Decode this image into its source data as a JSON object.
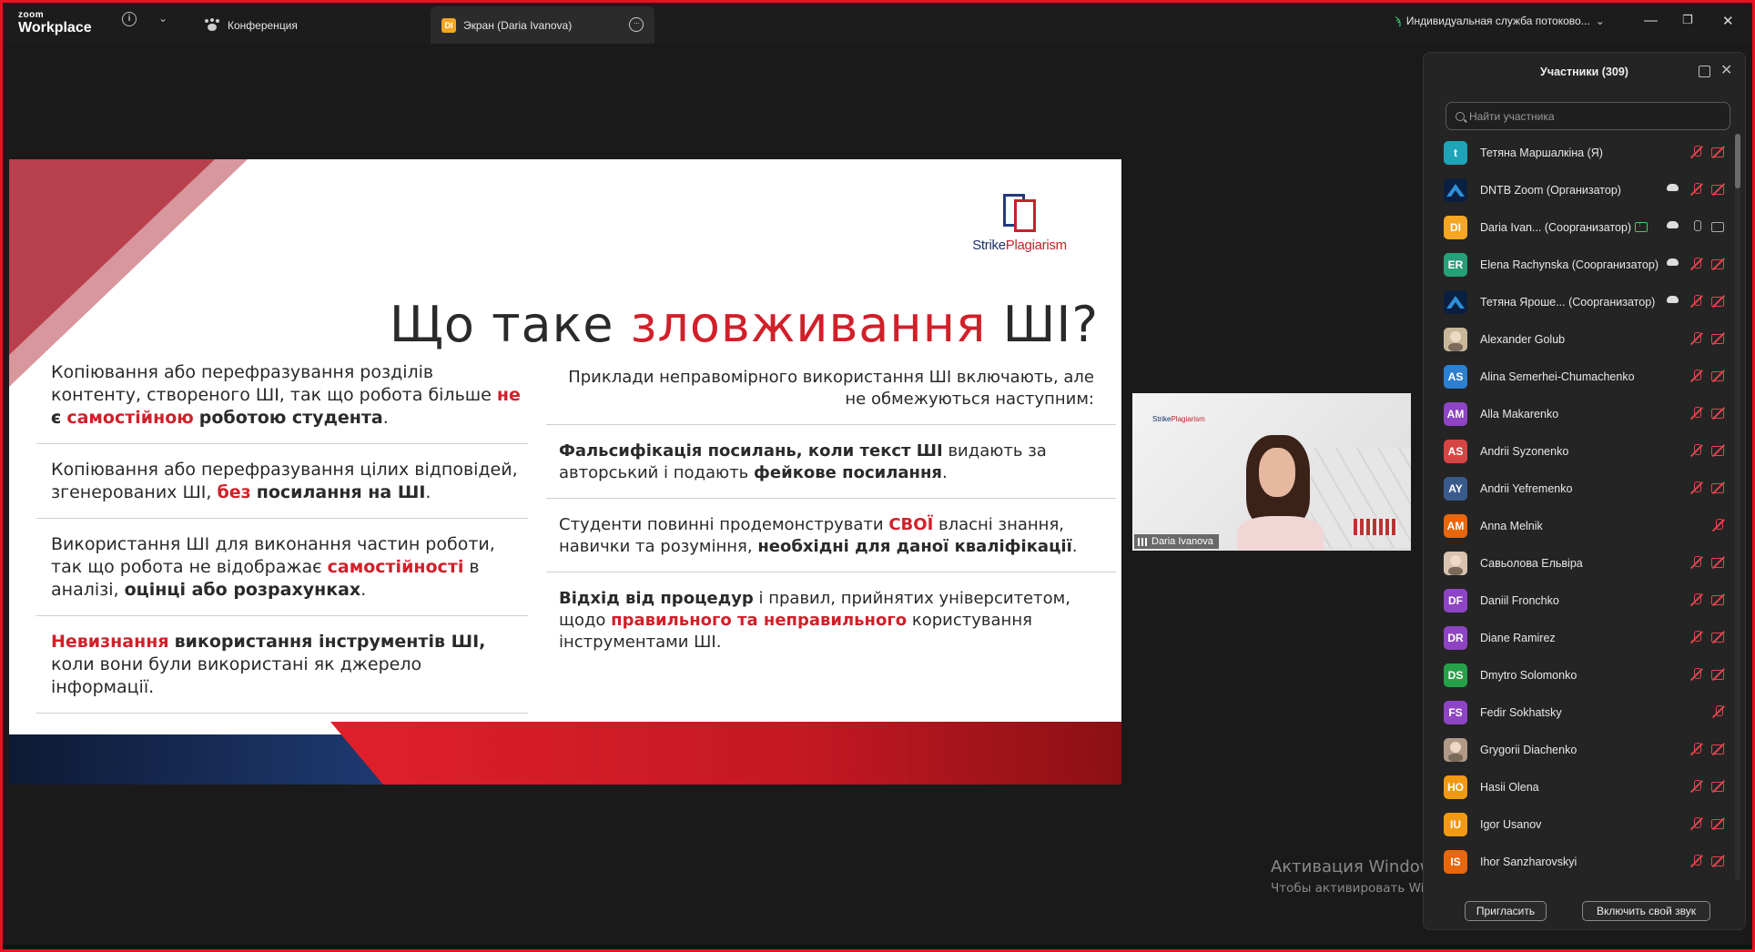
{
  "app": {
    "brand_small": "zoom",
    "brand_big": "Workplace"
  },
  "tabs": {
    "conference": "Конференция",
    "screen": "Экран (Daria Ivanova)",
    "screen_badge": "DI"
  },
  "stream": {
    "label": "Индивидуальная служба потоково..."
  },
  "slide": {
    "logo": {
      "strike": "Strike",
      "plagiarism": "Plagiarism"
    },
    "title_a": "Що таке ",
    "title_hl": "зловживання",
    "title_b": " ШІ?",
    "left": {
      "b1": {
        "t1": "Копіювання або перефразування розділів контенту, створеного ШІ, так що робота більше ",
        "r1": "не",
        "t2": " ",
        "b1": "є",
        "t3": " ",
        "r2": "самостійною",
        "t4": " ",
        "b2": "роботою студента",
        "t5": "."
      },
      "b2": {
        "t1": "Копіювання або перефразування цілих відповідей, згенерованих ШІ, ",
        "r1": "без",
        "t2": " ",
        "b1": "посилання на ШІ",
        "t3": "."
      },
      "b3": {
        "t1": "Використання ШІ для виконання частин роботи, так що робота не відображає ",
        "r1": "самостійності",
        "t2": " в аналізі, ",
        "b1": "оцінці або розрахунках",
        "t3": "."
      },
      "b4": {
        "r1": "Невизнання",
        "t1": " ",
        "b1": "використання інструментів ШІ,",
        "t2": " коли вони були використані як джерело інформації."
      }
    },
    "right": {
      "intro": "Приклади неправомірного використання ШІ включають, але не обмежуються наступним:",
      "b1": {
        "b1": "Фальсифікація посилань, коли текст ШІ",
        "t1": " видають за авторський і подають ",
        "b2": "фейкове посилання",
        "t2": "."
      },
      "b2": {
        "t1": "Студенти повинні продемонструвати ",
        "r1": "СВОЇ",
        "t2": " власні знання, навички та розуміння, ",
        "b1": "необхідні для даної кваліфікації",
        "t3": "."
      },
      "b3": {
        "b1": "Відхід від процедур",
        "t1": " і правил, прийнятих університетом, щодо ",
        "r1": "правильного та неправильного",
        "t2": " користування інструментами ШІ."
      }
    }
  },
  "video": {
    "name": "Daria Ivanova",
    "logo_strike": "Strike",
    "logo_plag": "Plagiarism"
  },
  "watermark": {
    "line1": "Активация Windows",
    "line2": "Чтобы активировать Windows, перейдите в раздел \"Параметры\"."
  },
  "panel": {
    "title": "Участники (309)",
    "search_placeholder": "Найти участника",
    "invite_label": "Пригласить",
    "unmute_label": "Включить свой звук",
    "participants": [
      {
        "initials": "t",
        "name": "Тетяна Маршалкіна (Я)",
        "color": "#1fa3b8",
        "cloud": false,
        "mic_on": false,
        "video_on": false
      },
      {
        "initials": "",
        "name": "DNTB Zoom (Организатор)",
        "color": "#0b2040",
        "cloud": true,
        "mic_on": false,
        "video_on": false,
        "logo": true
      },
      {
        "initials": "DI",
        "name": "Daria Ivan...  (Соорганизатор)",
        "color": "#f5a623",
        "cloud": true,
        "mic_on": true,
        "video_on": true,
        "sharing": true
      },
      {
        "initials": "ER",
        "name": "Elena Rachynska (Соорганизатор)",
        "color": "#27a07a",
        "cloud": true,
        "mic_on": false,
        "video_on": false
      },
      {
        "initials": "",
        "name": "Тетяна Яроше...  (Соорганизатор)",
        "color": "#0b2040",
        "cloud": true,
        "mic_on": false,
        "video_on": false,
        "logo": true
      },
      {
        "initials": "",
        "name": "Alexander Golub",
        "color": "#c9b79a",
        "cloud": false,
        "mic_on": false,
        "video_on": false,
        "photo": true
      },
      {
        "initials": "AS",
        "name": "Alina Semerhei-Chumachenko",
        "color": "#2d7fd1",
        "cloud": false,
        "mic_on": false,
        "video_on": false
      },
      {
        "initials": "AM",
        "name": "Alla Makarenko",
        "color": "#8e44c4",
        "cloud": false,
        "mic_on": false,
        "video_on": false
      },
      {
        "initials": "AS",
        "name": "Andrii Syzonenko",
        "color": "#d64545",
        "cloud": false,
        "mic_on": false,
        "video_on": false
      },
      {
        "initials": "AY",
        "name": "Andrii Yefremenko",
        "color": "#3a5a8c",
        "cloud": false,
        "mic_on": false,
        "video_on": false
      },
      {
        "initials": "AM",
        "name": "Anna Melnik",
        "color": "#e8670c",
        "cloud": false,
        "mic_on": false,
        "video_on": null
      },
      {
        "initials": "",
        "name": "Савьолова Ельвіра",
        "color": "#d8c3b0",
        "cloud": false,
        "mic_on": false,
        "video_on": false,
        "photo": true
      },
      {
        "initials": "DF",
        "name": "Daniil Fronchko",
        "color": "#8e44c4",
        "cloud": false,
        "mic_on": false,
        "video_on": false
      },
      {
        "initials": "DR",
        "name": "Diane Ramirez",
        "color": "#8e44c4",
        "cloud": false,
        "mic_on": false,
        "video_on": false
      },
      {
        "initials": "DS",
        "name": "Dmytro Solomonko",
        "color": "#27a04a",
        "cloud": false,
        "mic_on": false,
        "video_on": false
      },
      {
        "initials": "FS",
        "name": "Fedir Sokhatsky",
        "color": "#8e44c4",
        "cloud": false,
        "mic_on": false,
        "video_on": null
      },
      {
        "initials": "",
        "name": "Grygorii Diachenko",
        "color": "#b09a86",
        "cloud": false,
        "mic_on": false,
        "video_on": false,
        "photo": true
      },
      {
        "initials": "HO",
        "name": "Hasii Olena",
        "color": "#f09a12",
        "cloud": false,
        "mic_on": false,
        "video_on": false
      },
      {
        "initials": "IU",
        "name": "Igor Usanov",
        "color": "#f09a12",
        "cloud": false,
        "mic_on": false,
        "video_on": false
      },
      {
        "initials": "IS",
        "name": "Ihor Sanzharovskyi",
        "color": "#e8670c",
        "cloud": false,
        "mic_on": false,
        "video_on": false
      }
    ]
  }
}
